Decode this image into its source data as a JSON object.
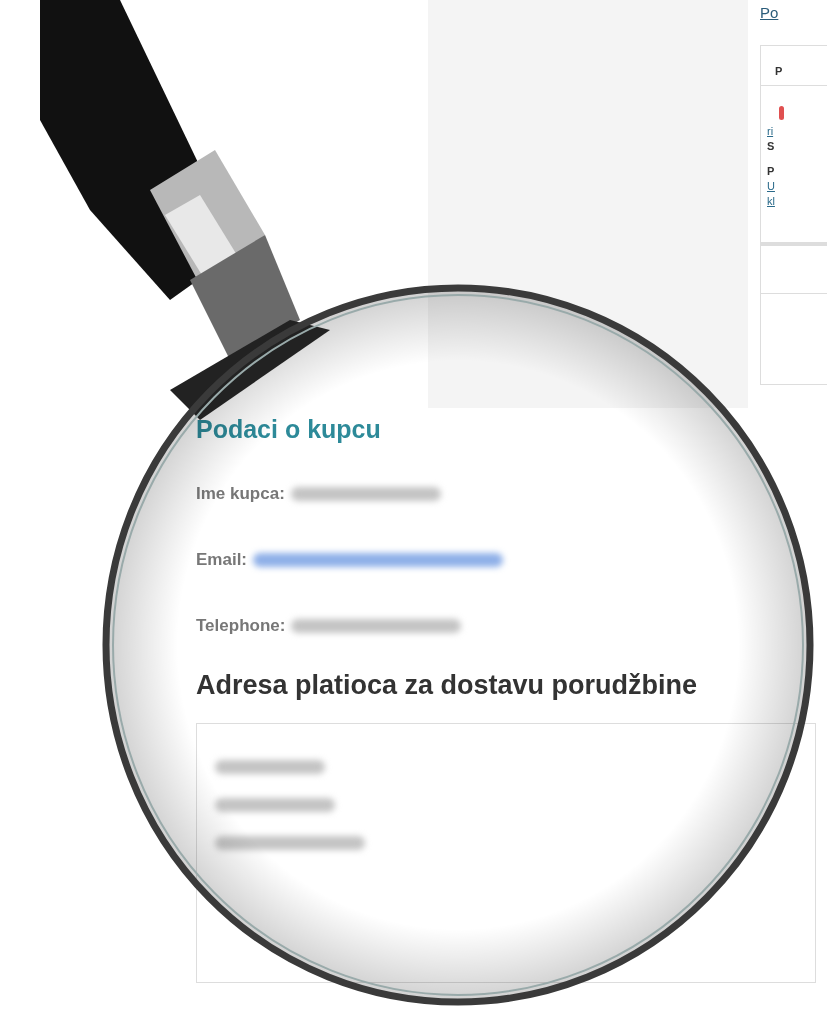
{
  "side_column": {
    "link": "Po",
    "table_header": "P",
    "lines": [
      {
        "kind": "link",
        "text": "ri"
      },
      {
        "kind": "bold",
        "text": "S"
      },
      {
        "kind": "bold",
        "text": "P"
      },
      {
        "kind": "link",
        "text": "U"
      },
      {
        "kind": "link",
        "text": "kl"
      }
    ]
  },
  "customer": {
    "title": "Podaci o kupcu",
    "fields": [
      {
        "label": "Ime kupca:",
        "kind": "plain"
      },
      {
        "label": "Email:",
        "kind": "link"
      },
      {
        "label": "Telephone:",
        "kind": "plain"
      }
    ]
  },
  "address": {
    "title": "Adresa platioca za dostavu porudžbine"
  }
}
